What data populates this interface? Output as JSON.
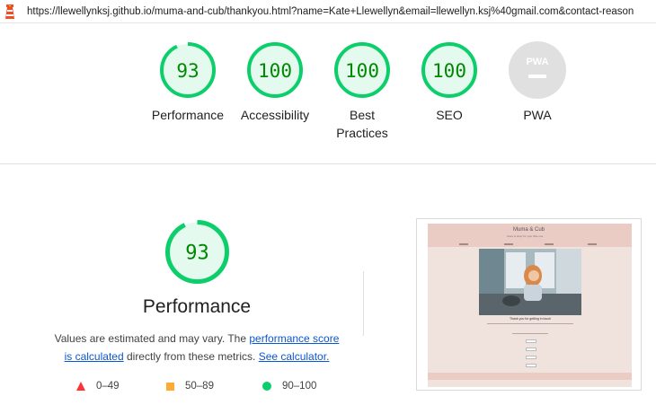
{
  "address_bar": {
    "url": "https://llewellynksj.github.io/muma-and-cub/thankyou.html?name=Kate+Llewellyn&email=llewellyn.ksj%40gmail.com&contact-reason"
  },
  "summary_gauges": [
    {
      "label": "Performance",
      "score": "93",
      "fraction": 0.93
    },
    {
      "label": "Accessibility",
      "score": "100",
      "fraction": 1.0
    },
    {
      "label": "Best\nPractices",
      "score": "100",
      "fraction": 1.0
    },
    {
      "label": "SEO",
      "score": "100",
      "fraction": 1.0
    },
    {
      "label": "PWA",
      "score": "PWA",
      "fraction": 0
    }
  ],
  "performance": {
    "score": "93",
    "fraction": 0.93,
    "title": "Performance",
    "desc_prefix": "Values are estimated and may vary. The ",
    "link_score": "performance score",
    "link_calculated": "is calculated",
    "desc_middle": " directly from these metrics. ",
    "link_calculator": "See calculator."
  },
  "legend": [
    {
      "range": "0–49",
      "shape": "triangle",
      "color": "#ff3333"
    },
    {
      "range": "50–89",
      "shape": "square",
      "color": "#ffaa33"
    },
    {
      "range": "90–100",
      "shape": "circle",
      "color": "#0cce6b"
    }
  ],
  "screenshot_preview": {
    "brand": "Muma & Cub",
    "tagline": "Store & shop for your little one",
    "thanks": "Thank you for getting in touch"
  },
  "colors": {
    "pass": "#0cce6b",
    "pass_text": "#008800",
    "pass_fill": "#e5faef",
    "pwa_gray": "#e0e0e0"
  }
}
